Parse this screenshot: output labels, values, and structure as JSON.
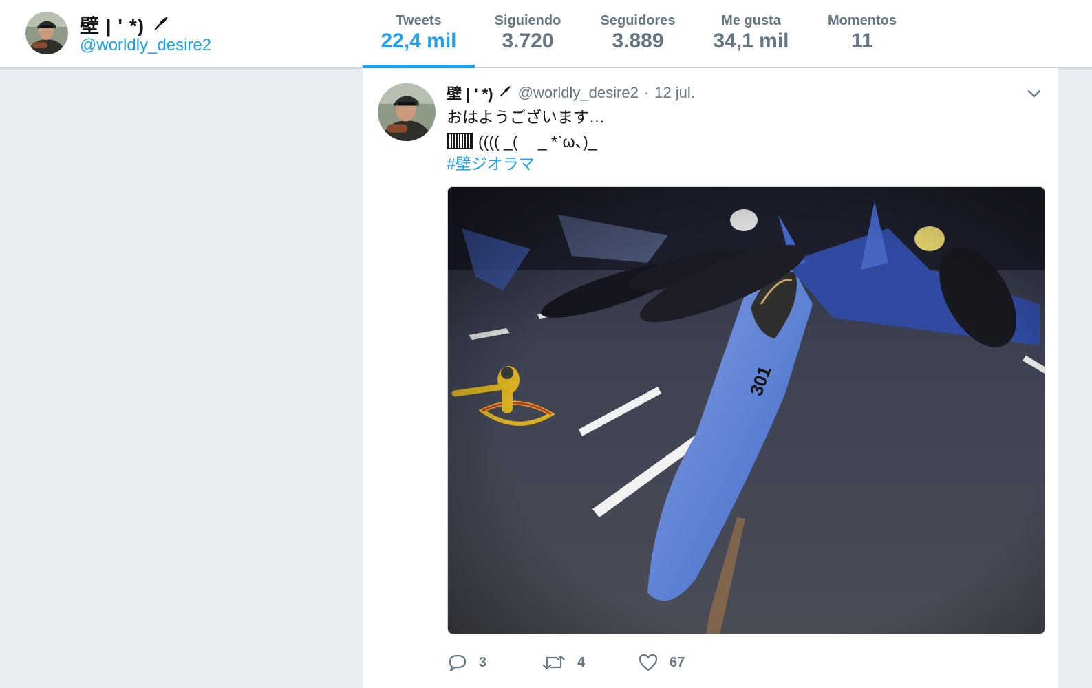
{
  "profile": {
    "name": "壁 | ' *)",
    "handle": "@worldly_desire2"
  },
  "stats": [
    {
      "label": "Tweets",
      "value": "22,4 mil",
      "active": true
    },
    {
      "label": "Siguiendo",
      "value": "3.720",
      "active": false
    },
    {
      "label": "Seguidores",
      "value": "3.889",
      "active": false
    },
    {
      "label": "Me gusta",
      "value": "34,1 mil",
      "active": false
    },
    {
      "label": "Momentos",
      "value": "11",
      "active": false
    }
  ],
  "tweet": {
    "name": "壁 | ' *)",
    "handle": "@worldly_desire2",
    "separator": "·",
    "time": "12 jul.",
    "text_line1": "おはようございます…",
    "text_line2": "(((( _(　  _ *`ω、)_",
    "hashtag": "#壁ジオラマ",
    "media_alt": "Diorama photo of a blue fighter jet model on a carrier deck",
    "actions": {
      "reply_count": "3",
      "retweet_count": "4",
      "like_count": "67"
    }
  },
  "colors": {
    "accent": "#1da1f2",
    "muted": "#657786",
    "page_bg": "#e6ecf0"
  },
  "icons": [
    "feather-icon",
    "chevron-down-icon",
    "reply-icon",
    "retweet-icon",
    "like-icon"
  ]
}
